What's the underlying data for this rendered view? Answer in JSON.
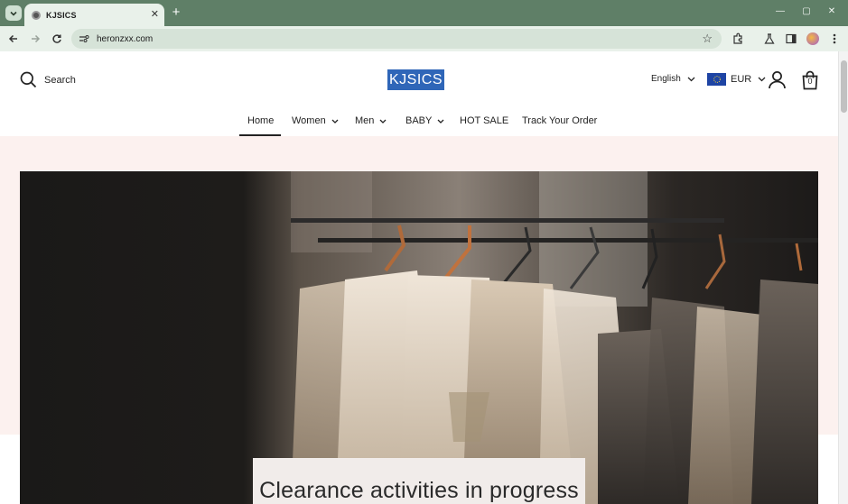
{
  "browser": {
    "tab_title": "KJSICS",
    "tab_close": "✕",
    "new_tab": "+",
    "url": "heronzxx.com",
    "window_controls": {
      "minimize": "—",
      "maximize": "▢",
      "close": "✕"
    }
  },
  "header": {
    "search_label": "Search",
    "logo_text": "KJSICS",
    "language": "English",
    "currency": "EUR",
    "cart_count": "0"
  },
  "nav": {
    "items": [
      {
        "label": "Home"
      },
      {
        "label": "Women"
      },
      {
        "label": "Men"
      },
      {
        "label": "BABY"
      },
      {
        "label": "HOT SALE"
      },
      {
        "label": "Track Your Order"
      }
    ],
    "active_index": 0
  },
  "hero": {
    "title": "Clearance activities in progress"
  },
  "colors": {
    "tabbar": "#5f7f67",
    "toolbar": "#e9f1ea",
    "logo_highlight": "#2f66b8",
    "band": "#fcf1ef",
    "flag": "#1e44a4"
  }
}
